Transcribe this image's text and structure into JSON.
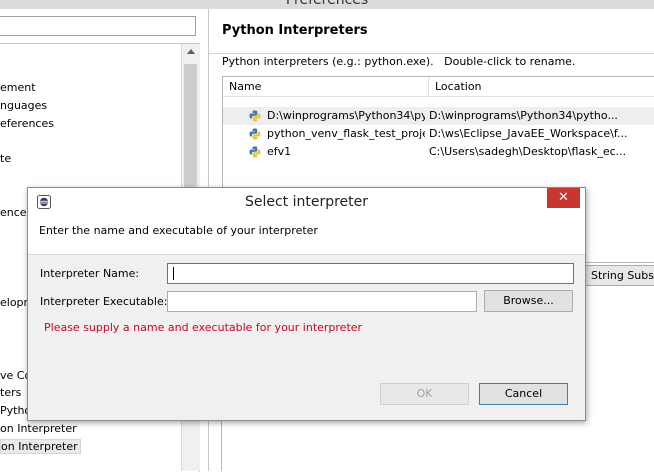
{
  "window": {
    "title": "Preferences"
  },
  "sidebar": {
    "filter_value": "",
    "items": [
      {
        "label": "ement"
      },
      {
        "label": "nguages"
      },
      {
        "label": "eferences"
      },
      {
        "label": "te"
      },
      {
        "label": "ence"
      },
      {
        "label": "elopr"
      },
      {
        "label": "ve Co"
      },
      {
        "label": "ters"
      },
      {
        "label": "Pytho"
      },
      {
        "label": "on Interpreter"
      },
      {
        "label": "on Interpreter"
      }
    ]
  },
  "main": {
    "section_title": "Python Interpreters",
    "description": "Python interpreters (e.g.: python.exe).   Double-click to rename.",
    "columns": [
      "Name",
      "Location"
    ],
    "rows": [
      {
        "name": "D:\\winprograms\\Python34\\py",
        "location": "D:\\winprograms\\Python34\\pytho..."
      },
      {
        "name": "python_venv_flask_test_projec",
        "location": "D:\\ws\\Eclipse_JavaEE_Workspace\\f..."
      },
      {
        "name": "efv1",
        "location": "C:\\Users\\sadegh\\Desktop\\flask_ec..."
      }
    ],
    "string_subst_label": "String Subst"
  },
  "dialog": {
    "title": "Select interpreter",
    "close_glyph": "✕",
    "header_text": "Enter the name and executable of your interpreter",
    "name_label": "Interpreter Name:",
    "name_value": "",
    "executable_label": "Interpreter Executable:",
    "executable_value": "",
    "browse_label": "Browse...",
    "error_text": "Please supply a name and executable for your interpreter",
    "ok_label": "OK",
    "cancel_label": "Cancel"
  },
  "colors": {
    "close_button": "#c7372f",
    "error_text": "#d0021b",
    "focus_border": "#3c7fb1"
  },
  "icons": [
    "python-icon",
    "eclipse-app-icon",
    "close-icon"
  ]
}
